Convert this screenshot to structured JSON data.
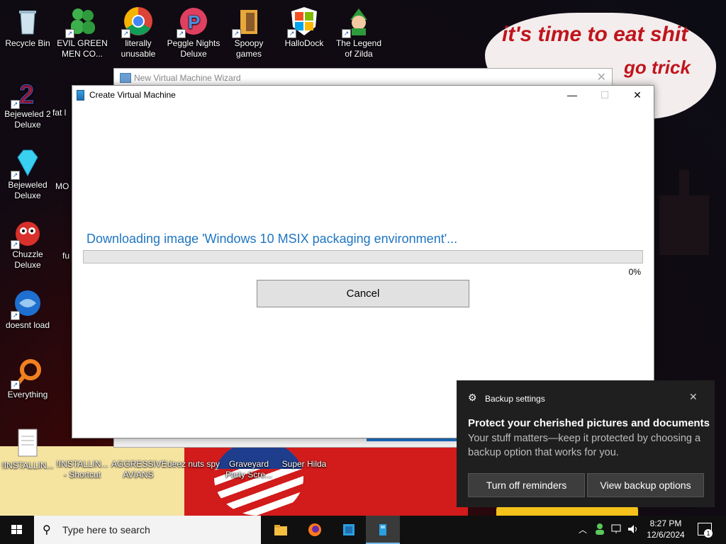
{
  "desktop": {
    "wallpaper_text_1": "it's time to eat shit",
    "wallpaper_text_2": "go trick",
    "icons": [
      {
        "label": "Recycle Bin"
      },
      {
        "label": "EVIL GREEN MEN CO..."
      },
      {
        "label": "literally unusable"
      },
      {
        "label": "Peggle Nights Deluxe"
      },
      {
        "label": "Spoopy games"
      },
      {
        "label": "HalloDock"
      },
      {
        "label": "The Legend of Zilda"
      },
      {
        "label": "Bejeweled 2 Deluxe"
      },
      {
        "label": "fat l"
      },
      {
        "label": "Bejeweled Deluxe"
      },
      {
        "label": "MO"
      },
      {
        "label": "Chuzzle Deluxe"
      },
      {
        "label": "fu"
      },
      {
        "label": "doesnt load"
      },
      {
        "label": "Everything"
      },
      {
        "label": "!INSTALLIN..."
      },
      {
        "label": "!INSTALLIN... - Shortcut"
      },
      {
        "label": "AGGRESSIVE AVIANS"
      },
      {
        "label": "deez nuts spy"
      },
      {
        "label": "Graveyard Party Scre..."
      },
      {
        "label": "Super Hilda"
      }
    ]
  },
  "back_window": {
    "title": "New Virtual Machine Wizard"
  },
  "dialog": {
    "title": "Create Virtual Machine",
    "message": "Downloading image 'Windows 10 MSIX packaging environment'...",
    "progress_percent": 0,
    "progress_label": "0%",
    "cancel_label": "Cancel"
  },
  "toast": {
    "app_name": "Backup settings",
    "heading": "Protect your cherished pictures and documents",
    "body": "Your stuff matters—keep it protected by choosing a backup option that works for you.",
    "btn_turn_off": "Turn off reminders",
    "btn_view": "View backup options"
  },
  "taskbar": {
    "search_placeholder": "Type here to search",
    "time": "8:27 PM",
    "date": "12/6/2024",
    "notification_count": "1"
  },
  "colors": {
    "accent_blue": "#1f75c2",
    "toast_bg": "#1f1f1f",
    "taskbar_bg": "#101010"
  }
}
